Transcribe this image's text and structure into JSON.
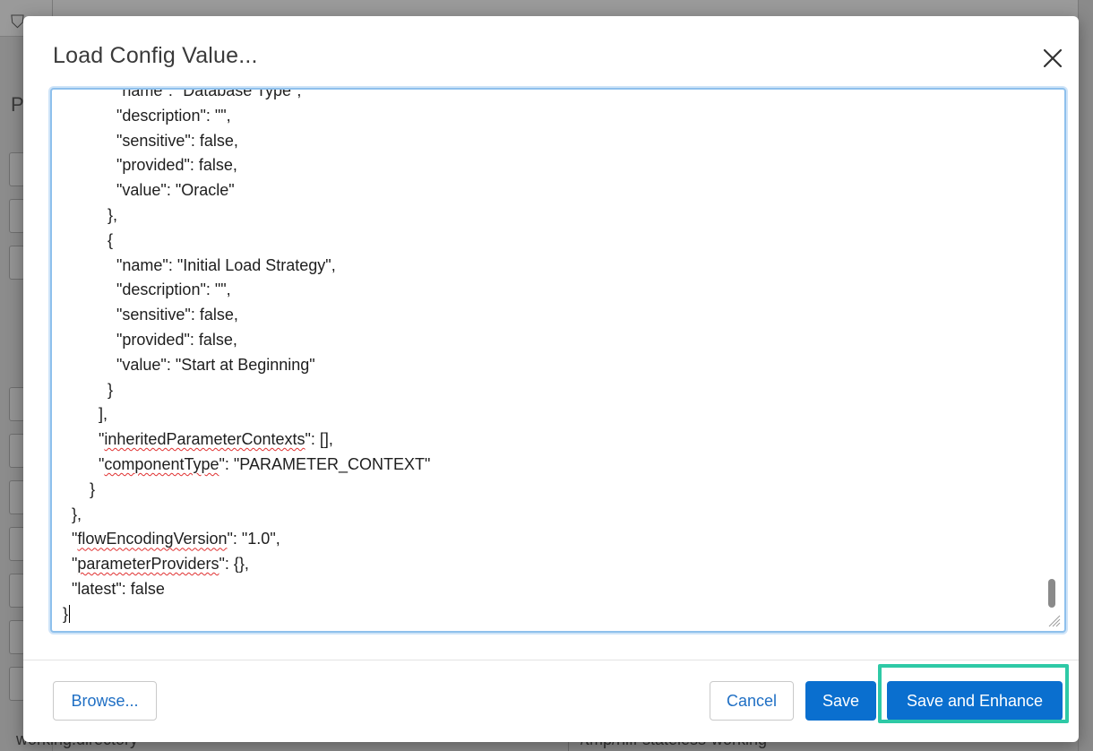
{
  "background": {
    "bottom_left_text": "working.directory",
    "bottom_right_text": "/tmp/nifi-stateless-working",
    "side_letter": "P"
  },
  "dialog": {
    "title": "Load Config Value...",
    "close_icon": "close-icon"
  },
  "editor": {
    "lines": [
      "            \"name\": \"Database Type\",",
      "            \"description\": \"\",",
      "            \"sensitive\": false,",
      "            \"provided\": false,",
      "            \"value\": \"Oracle\"",
      "          },",
      "          {",
      "            \"name\": \"Initial Load Strategy\",",
      "            \"description\": \"\",",
      "            \"sensitive\": false,",
      "            \"provided\": false,",
      "            \"value\": \"Start at Beginning\"",
      "          }",
      "        ],",
      "        \"inheritedParameterContexts\": [],",
      "        \"componentType\": \"PARAMETER_CONTEXT\"",
      "      }",
      "  },",
      "  \"flowEncodingVersion\": \"1.0\",",
      "  \"parameterProviders\": {},",
      "  \"latest\": false",
      "}"
    ],
    "misspelled": [
      "inheritedParameterContexts",
      "componentType",
      "flowEncodingVersion",
      "parameterProviders"
    ]
  },
  "footer": {
    "browse_label": "Browse...",
    "cancel_label": "Cancel",
    "save_label": "Save",
    "save_enhance_label": "Save and Enhance"
  },
  "colors": {
    "primary": "#0a6fcf",
    "highlight": "#2ec9a6",
    "focus_border": "#8ec0ec"
  }
}
